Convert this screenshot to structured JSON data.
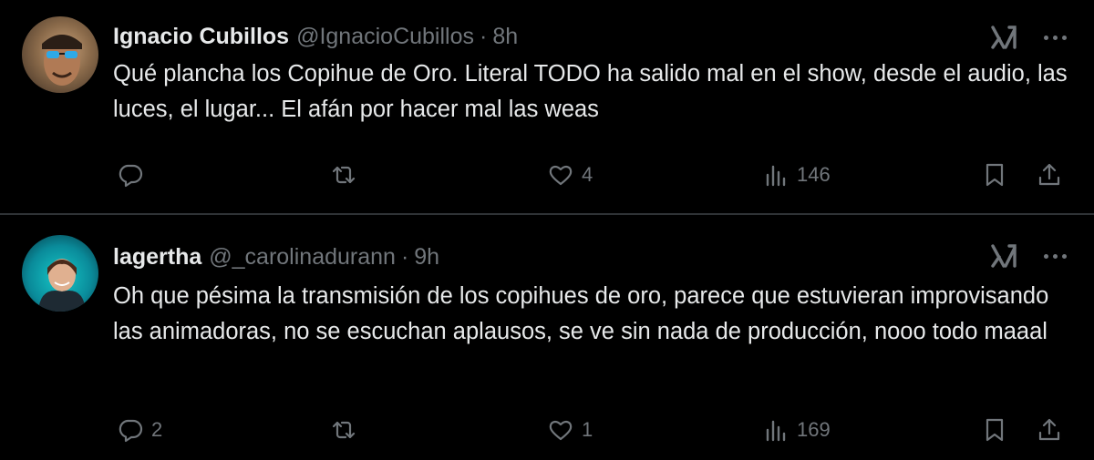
{
  "tweets": [
    {
      "name": "Ignacio Cubillos",
      "handle": "@IgnacioCubillos",
      "separator": "·",
      "time": "8h",
      "text": "Qué plancha los Copihue de Oro. Literal TODO ha salido mal en el show, desde el audio, las luces, el lugar... El afán por hacer mal las weas",
      "replies": "",
      "retweets": "",
      "likes": "4",
      "views": "146"
    },
    {
      "name": "lagertha",
      "handle": "@_carolinadurann",
      "separator": "·",
      "time": "9h",
      "text": "Oh que pésima la transmisión de los copihues de oro, parece que estuvieran improvisando las animadoras, no se escuchan aplausos, se ve sin nada de producción, nooo todo maaal",
      "replies": "2",
      "retweets": "",
      "likes": "1",
      "views": "169"
    }
  ],
  "icons": {
    "reply": "reply-icon",
    "retweet": "retweet-icon",
    "like": "heart-icon",
    "views": "views-icon",
    "bookmark": "bookmark-icon",
    "share": "share-icon",
    "grok": "grok-icon",
    "more": "more-icon"
  },
  "colors": {
    "background": "#000000",
    "text": "#e7e9ea",
    "secondary": "#71767b",
    "divider": "#2f3336"
  }
}
